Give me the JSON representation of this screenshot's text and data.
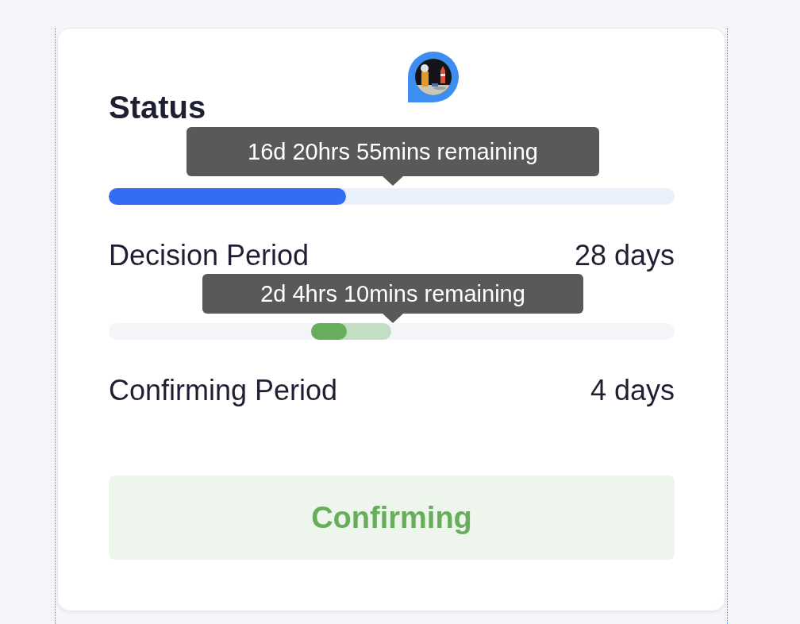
{
  "status": {
    "title": "Status",
    "periods": [
      {
        "kind": "decision",
        "tooltip": "16d 20hrs 55mins remaining",
        "level": 0.42,
        "label": "Decision Period",
        "duration": "28 days"
      },
      {
        "kind": "confirming",
        "tooltip": "2d 4hrs 10mins remaining",
        "level": 0.45,
        "label": "Confirming Period",
        "duration": "4 days"
      }
    ],
    "state_button": "Confirming"
  }
}
